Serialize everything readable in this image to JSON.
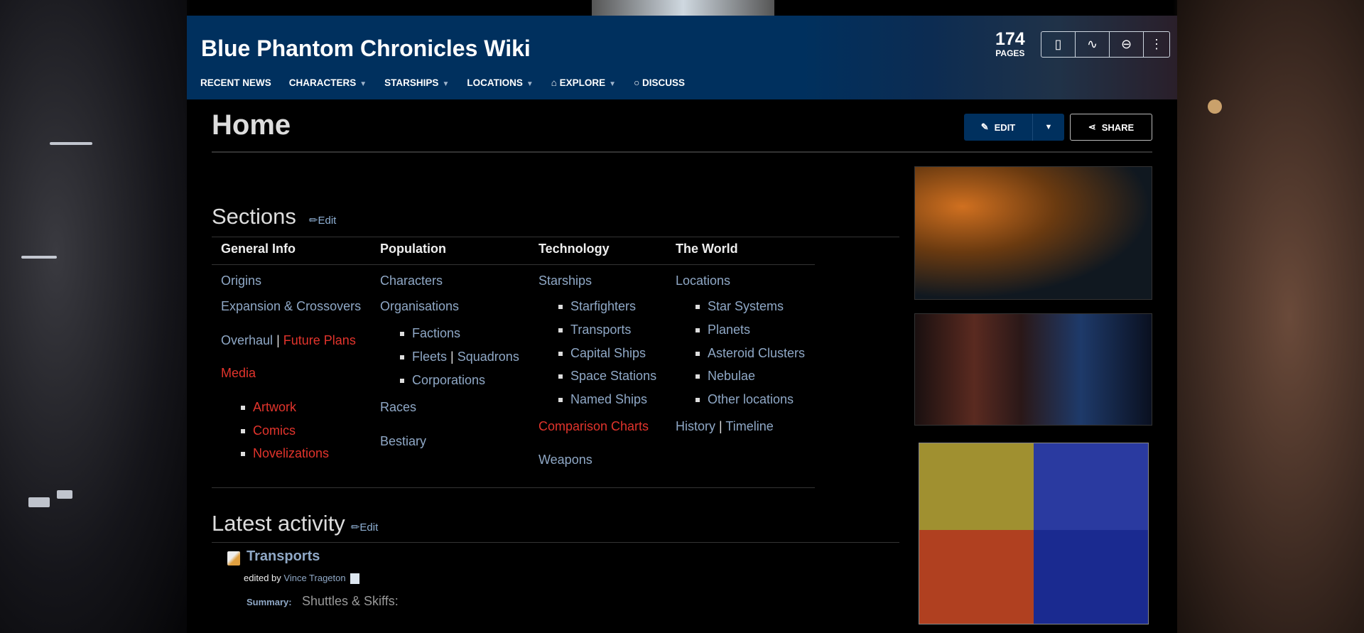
{
  "site": {
    "title": "Blue Phantom Chronicles Wiki",
    "pages_count": "174",
    "pages_label": "PAGES"
  },
  "nav": {
    "items": [
      "RECENT NEWS",
      "CHARACTERS",
      "STARSHIPS",
      "LOCATIONS",
      "EXPLORE",
      "DISCUSS"
    ]
  },
  "page": {
    "title": "Home",
    "edit_label": "EDIT",
    "share_label": "SHARE"
  },
  "sections": {
    "heading": "Sections",
    "edit": "Edit",
    "columns": [
      {
        "header": "General Info",
        "items": [
          "Origins",
          "Expansion & Crossovers",
          "Overhaul",
          "|",
          "Future Plans",
          "Media",
          "Artwork",
          "Comics",
          "Novelizations"
        ]
      },
      {
        "header": "Population",
        "items": [
          "Characters",
          "Organisations",
          "Factions",
          "Fleets",
          "|",
          "Squadrons",
          "Corporations",
          "Races",
          "Bestiary"
        ]
      },
      {
        "header": "Technology",
        "items": [
          "Starships",
          "Starfighters",
          "Transports",
          "Capital Ships",
          "Space Stations",
          "Named Ships",
          "Comparison Charts",
          "Weapons"
        ]
      },
      {
        "header": "The World",
        "items": [
          "Locations",
          "Star Systems",
          "Planets",
          "Asteroid Clusters",
          "Nebulae",
          "Other locations",
          "History",
          "|",
          "Timeline"
        ]
      }
    ]
  },
  "activity": {
    "heading": "Latest activity",
    "edit": "Edit",
    "title": "Transports",
    "edited_by": "edited by",
    "user": "Vince Trageton",
    "summary_label": "Summary:",
    "summary": "Shuttles & Skiffs:"
  },
  "colors": {
    "header": "#00305e",
    "link": "#8fa8c6",
    "redlink": "#e2342c"
  }
}
